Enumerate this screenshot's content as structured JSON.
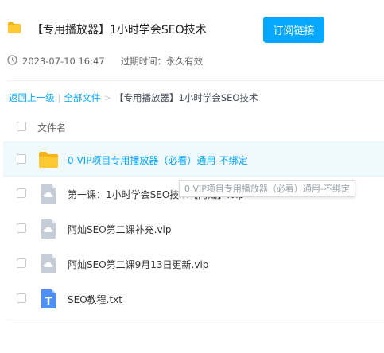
{
  "header": {
    "title": "【专用播放器】1小时学会SEO技术",
    "subscribe_label": "订阅链接",
    "timestamp": "2023-07-10 16:47",
    "expiry_label": "过期时间：",
    "expiry_value": "永久有效"
  },
  "breadcrumb": {
    "back": "返回上一级",
    "sep1": "|",
    "all_files": "全部文件",
    "sep2": ">",
    "current": "【专用播放器】1小时学会SEO技术"
  },
  "list": {
    "column_name": "文件名",
    "files": [
      {
        "name": "0 VIP项目专用播放器（必看）通用-不绑定",
        "type": "folder"
      },
      {
        "name": "第一课：1小时学会SEO技术【阿灿】.vip",
        "type": "file"
      },
      {
        "name": "阿灿SEO第二课补充.vip",
        "type": "file"
      },
      {
        "name": "阿灿SEO第二课9月13日更新.vip",
        "type": "file"
      },
      {
        "name": "SEO教程.txt",
        "type": "txt"
      }
    ]
  },
  "tooltip": {
    "text": "0 VIP项目专用播放器（必看）通用-不绑定"
  },
  "colors": {
    "accent": "#06a7ff",
    "folder": "#ffc933",
    "file_icon": "#c5cdd8",
    "txt_icon": "#4c8ff5"
  }
}
